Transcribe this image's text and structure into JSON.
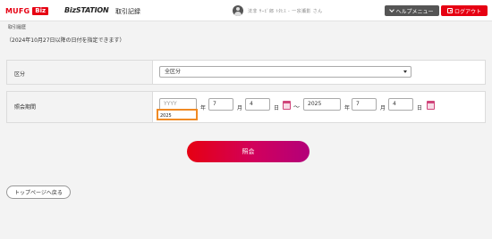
{
  "header": {
    "brand": "MUFG",
    "brand_badge": "Biz",
    "product": "BizSTATION",
    "page_name": "取引記録",
    "user_name": "法非 ｻｰﾋﾞ郎 ﾄﾀﾋｽ - 一宗瀬影 さん",
    "help_label": "ヘルプメニュー",
    "logout_label": "ログアウト"
  },
  "breadcrumb": "取引履歴",
  "note": "（2024年10月27日以降の日付を指定できます）",
  "filters": {
    "category": {
      "label": "区分",
      "selected": "全区分"
    },
    "period": {
      "label": "照会期間",
      "from": {
        "year_placeholder": "YYYY",
        "year": "",
        "month": "7",
        "day": "4"
      },
      "to": {
        "year": "2025",
        "month": "7",
        "day": "4"
      },
      "units": {
        "year": "年",
        "month": "月",
        "day": "日"
      },
      "separator": "～",
      "autocomplete_suggestion": "2025"
    }
  },
  "actions": {
    "search_label": "照会",
    "back_label": "トップページへ戻る"
  }
}
